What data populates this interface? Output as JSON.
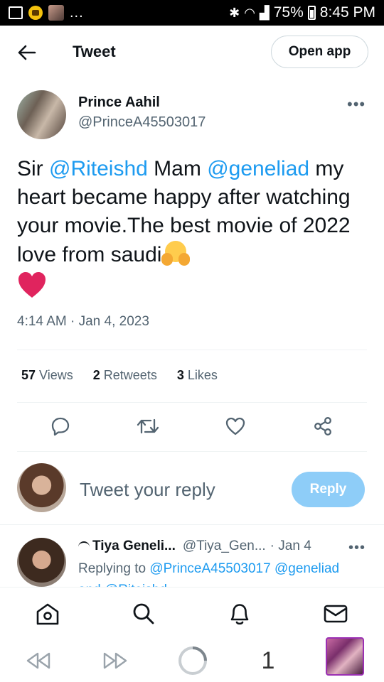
{
  "status_bar": {
    "battery": "75%",
    "time": "8:45 PM",
    "overflow": "..."
  },
  "header": {
    "title": "Tweet",
    "open_app_label": "Open app"
  },
  "tweet": {
    "author_name": "Prince Aahil",
    "author_handle": "@PrinceA45503017",
    "more": "•••",
    "text": {
      "sir": "Sir ",
      "mention1": "@Riteishd",
      "mam": " Mam ",
      "mention2": "@geneliad",
      "body": " my heart became happy after watching your movie.The best movie of 2022 love from saudi"
    },
    "timestamp": "4:14 AM · Jan 4, 2023",
    "stats": {
      "views_count": "57",
      "views_label": "Views",
      "retweets_count": "2",
      "retweets_label": "Retweets",
      "likes_count": "3",
      "likes_label": "Likes"
    }
  },
  "composer": {
    "placeholder": "Tweet your reply",
    "reply_button": "Reply"
  },
  "reply_item": {
    "name": "Tiya Geneli...",
    "handle": "@Tiya_Gen...",
    "time": "· Jan 4",
    "more": "•••",
    "replying_prefix": "Replying to ",
    "replying_mention1": "@PrinceA45503017",
    "replying_mention2": "@geneliad",
    "replying_more": "and @Riteishd"
  },
  "browser": {
    "tab_count": "1"
  },
  "colors": {
    "accent": "#1d9bf0",
    "reply_button": "#8ecdf8",
    "muted": "#536471",
    "heart": "#e0245e"
  }
}
